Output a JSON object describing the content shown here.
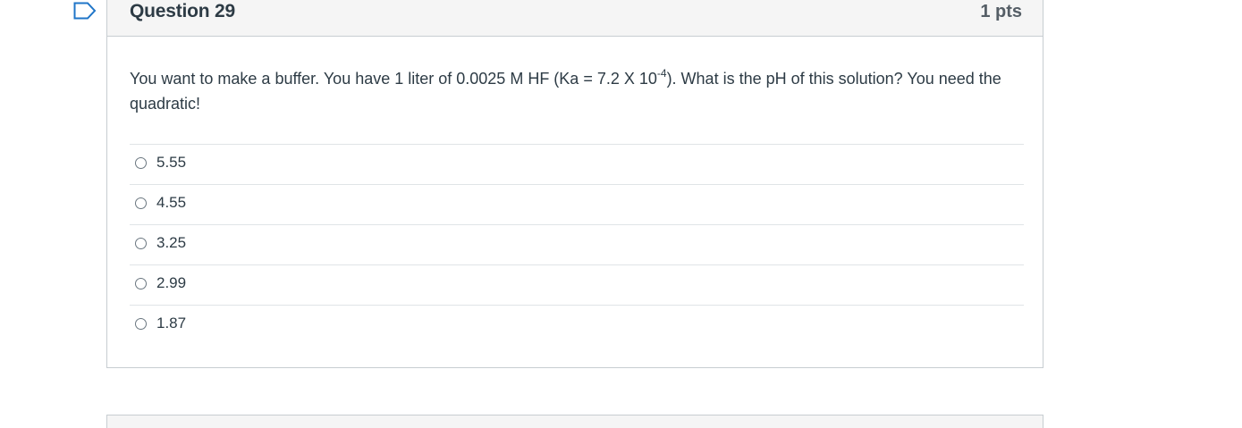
{
  "question": {
    "title": "Question 29",
    "points": "1 pts",
    "text_before": "You want to make a buffer.  You have 1 liter of 0.0025 M HF (Ka = 7.2 X 10",
    "superscript": "-4",
    "text_after": ").  What is the pH of this solution?   You need the quadratic!",
    "answers": [
      {
        "label": "5.55"
      },
      {
        "label": "4.55"
      },
      {
        "label": "3.25"
      },
      {
        "label": "2.99"
      },
      {
        "label": "1.87"
      }
    ]
  },
  "icons": {
    "flag": "flag-outline-icon"
  },
  "colors": {
    "flag": "#1f75c8",
    "header_bg": "#f5f5f5",
    "border": "#c7cdd1",
    "text": "#2d3b45"
  }
}
